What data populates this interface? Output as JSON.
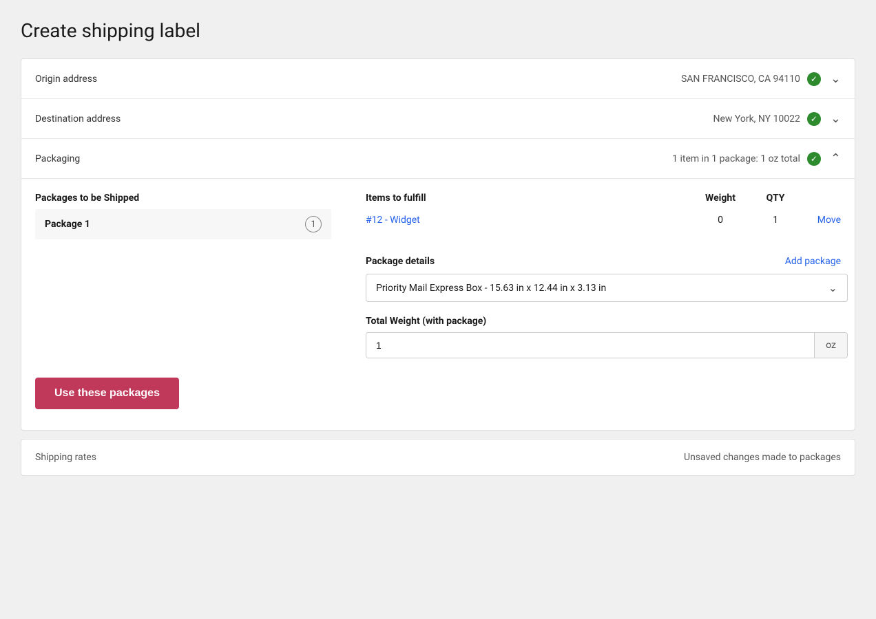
{
  "page": {
    "title": "Create shipping label"
  },
  "origin": {
    "label": "Origin address",
    "value": "SAN FRANCISCO, CA  94110",
    "verified": true
  },
  "destination": {
    "label": "Destination address",
    "value": "New York, NY  10022",
    "verified": true
  },
  "packaging": {
    "label": "Packaging",
    "summary": "1 item in 1 package: 1 oz total",
    "verified": true,
    "table": {
      "col_packages": "Packages to be Shipped",
      "col_items": "Items to fulfill",
      "col_weight": "Weight",
      "col_qty": "QTY"
    },
    "package": {
      "name": "Package 1",
      "badge": "1",
      "item": {
        "name": "#12 - Widget",
        "weight": "0",
        "qty": "1",
        "move_label": "Move"
      }
    },
    "package_details": {
      "label": "Package details",
      "add_package_label": "Add package",
      "selected_package": "Priority Mail Express Box - 15.63 in x 12.44 in x 3.13 in"
    },
    "total_weight": {
      "label": "Total Weight (with package)",
      "value": "1",
      "unit": "oz"
    },
    "use_packages_button": "Use these packages"
  },
  "shipping_rates": {
    "label": "Shipping rates",
    "unsaved_label": "Unsaved changes made to packages"
  }
}
